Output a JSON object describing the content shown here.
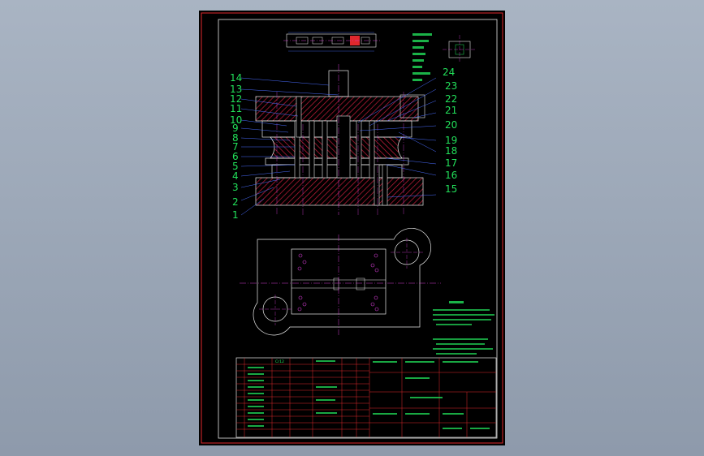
{
  "callout_numbers": [
    "14",
    "13",
    "12",
    "11",
    "10",
    "9",
    "8",
    "7",
    "6",
    "5",
    "4",
    "3",
    "2",
    "1",
    "24",
    "23",
    "22",
    "21",
    "20",
    "19",
    "18",
    "17",
    "16",
    "15"
  ],
  "title_block_label": "Cr12",
  "colors": {
    "background": "#9aa6b6",
    "sheet": "#000000",
    "frame": "#e0282d",
    "outline": "#e8e8e8",
    "label": "#22e05a",
    "centerline": "#d23cd2",
    "leader": "#4a6dff",
    "hatch": "#c81e3c",
    "accent": "#ff3030"
  }
}
